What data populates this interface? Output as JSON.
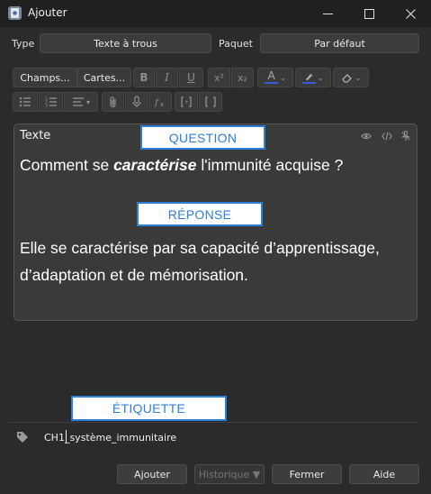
{
  "window": {
    "title": "Ajouter",
    "icon": "anki-app-icon"
  },
  "type_row": {
    "type_label": "Type",
    "type_value": "Texte à trous",
    "deck_label": "Paquet",
    "deck_value": "Par défaut"
  },
  "toolbar": {
    "fields_button": "Champs...",
    "cards_button": "Cartes...",
    "icons": [
      "bold-icon",
      "italic-icon",
      "underline-icon",
      "superscript-icon",
      "subscript-icon",
      "text-color-icon",
      "highlight-icon",
      "eraser-icon",
      "bullet-list-icon",
      "numbered-list-icon",
      "align-icon",
      "attachment-icon",
      "microphone-icon",
      "formula-icon",
      "cloze-icon",
      "cloze-same-icon"
    ],
    "bold": "B",
    "italic": "I",
    "underline": "U",
    "superscript": "x²",
    "subscript": "x₂",
    "text_color_letter": "A",
    "text_color": "#3a5ad9",
    "highlight_color": "#3a5ad9"
  },
  "field": {
    "name": "Texte",
    "line1_before": "Comment se ",
    "line1_emph": "caractérise",
    "line1_after": " l'immunité acquise ?",
    "line2": "Elle se caractérise par sa capacité d’apprentissage, d’adaptation et de mémorisation."
  },
  "overlays": {
    "question": "QUESTION",
    "answer": "RÉPONSE",
    "tag": "ÉTIQUETTE",
    "color": "#2e7fd8"
  },
  "tags": {
    "value": "CH1_système_immunitaire"
  },
  "footer": {
    "add": "Ajouter",
    "history": "Historique ▼",
    "close": "Fermer",
    "help": "Aide"
  }
}
